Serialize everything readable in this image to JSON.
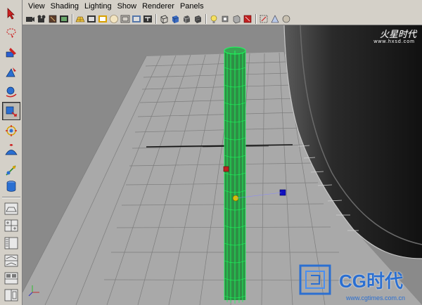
{
  "menubar": {
    "items": [
      "View",
      "Shading",
      "Lighting",
      "Show",
      "Renderer",
      "Panels"
    ]
  },
  "toolbox": {
    "tools": [
      {
        "name": "select-tool-icon"
      },
      {
        "name": "lasso-tool-icon"
      },
      {
        "name": "paint-select-tool-icon"
      },
      {
        "name": "move-tool-icon"
      },
      {
        "name": "rotate-tool-icon"
      },
      {
        "name": "scale-tool-icon",
        "active": true
      },
      {
        "name": "universal-manipulator-icon"
      },
      {
        "name": "soft-modification-icon"
      },
      {
        "name": "show-manipulator-icon"
      },
      {
        "name": "last-tool-icon"
      }
    ],
    "layouts": [
      {
        "name": "single-perspective-layout-icon"
      },
      {
        "name": "four-view-layout-icon"
      },
      {
        "name": "persp-outliner-layout-icon"
      },
      {
        "name": "persp-graph-layout-icon"
      },
      {
        "name": "hypershade-persp-layout-icon"
      },
      {
        "name": "persp-uv-layout-icon"
      }
    ]
  },
  "watermark": {
    "top_text": "火星时代",
    "top_url": "www.hxsd.com",
    "logo_text": "CG时代",
    "logo_url": "www.cgtimes.com.cn"
  },
  "colors": {
    "viewport_bg": "#8a8a8a",
    "ground": "#a8a8a8",
    "grid_line": "#7d7d7d",
    "wireframe": "#1aff5e",
    "cylinder_fill": "#2f9a4a",
    "dark_shape": "#1c1c1c"
  }
}
